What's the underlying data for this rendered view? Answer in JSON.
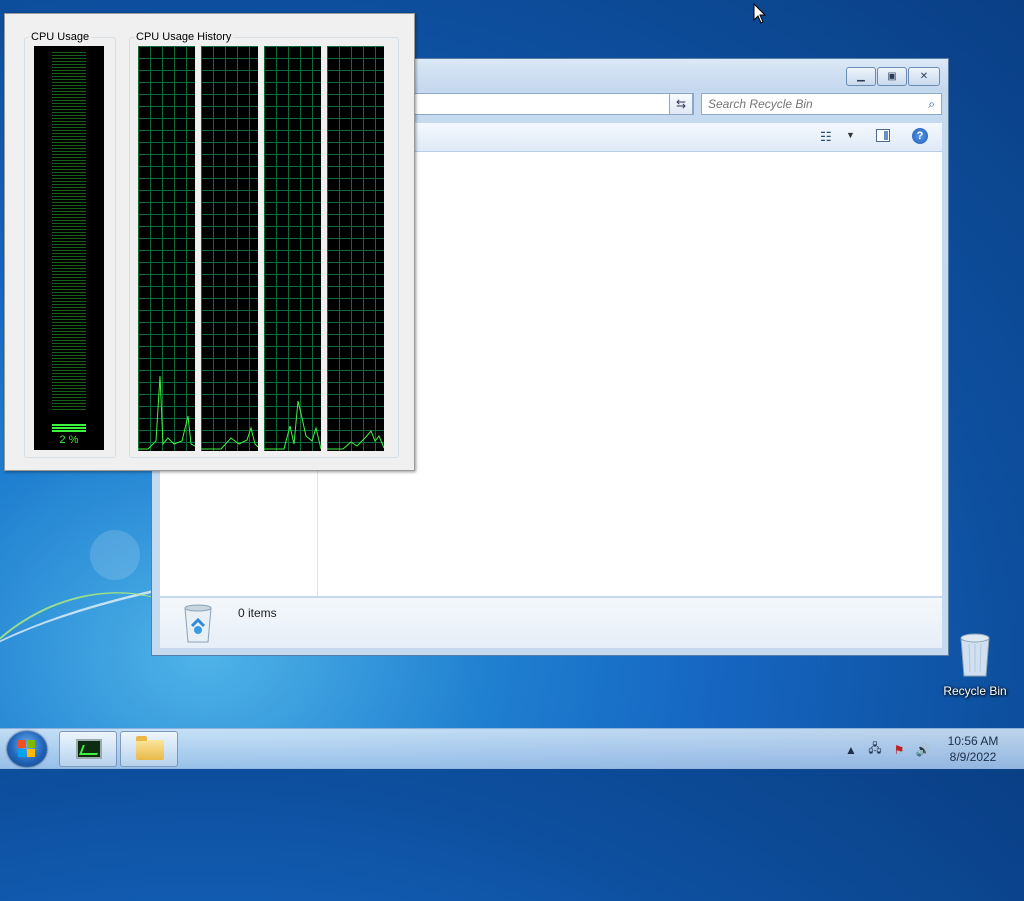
{
  "explorer": {
    "search": {
      "placeholder": "Search Recycle Bin"
    },
    "details": {
      "item_count": "0 items"
    }
  },
  "task_manager": {
    "cpu_usage_label": "CPU Usage",
    "cpu_history_label": "CPU Usage History",
    "cpu_percent_text": "2 %",
    "cpu_percent_value": 0.02,
    "meter_color": "#3ef53e",
    "grid_color": "#0f6b3a"
  },
  "desktop": {
    "icons": [
      {
        "label": "Recycle Bin",
        "icon": "recycle-bin-icon"
      }
    ]
  },
  "taskbar": {
    "items": [
      {
        "name": "task-manager",
        "icon": "task-manager-icon"
      },
      {
        "name": "windows-explorer",
        "icon": "folder-icon"
      }
    ],
    "tray_icons": [
      "show-hidden-icons-arrow",
      "network-icon",
      "action-center-flag-icon",
      "volume-icon"
    ],
    "clock": {
      "time": "10:56 AM",
      "date": "8/9/2022"
    }
  }
}
